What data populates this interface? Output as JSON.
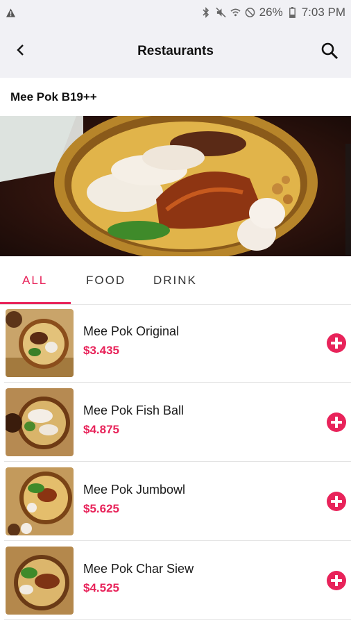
{
  "status_bar": {
    "battery": "26%",
    "time": "7:03 PM",
    "icons": [
      "warning-icon",
      "bluetooth-icon",
      "mute-icon",
      "wifi-icon",
      "no-disturb-icon",
      "battery-icon"
    ]
  },
  "app_bar": {
    "title": "Restaurants"
  },
  "restaurant": {
    "name": "Mee Pok B19++"
  },
  "tabs": [
    {
      "label": "ALL",
      "active": true
    },
    {
      "label": "FOOD",
      "active": false
    },
    {
      "label": "DRINK",
      "active": false
    }
  ],
  "menu_items": [
    {
      "name": "Mee Pok Original",
      "price": "$3.435"
    },
    {
      "name": "Mee Pok Fish Ball",
      "price": "$4.875"
    },
    {
      "name": "Mee Pok Jumbowl",
      "price": "$5.625"
    },
    {
      "name": "Mee Pok Char Siew",
      "price": "$4.525"
    }
  ],
  "colors": {
    "accent": "#e8235a",
    "app_bar_bg": "#f1f1f5"
  }
}
